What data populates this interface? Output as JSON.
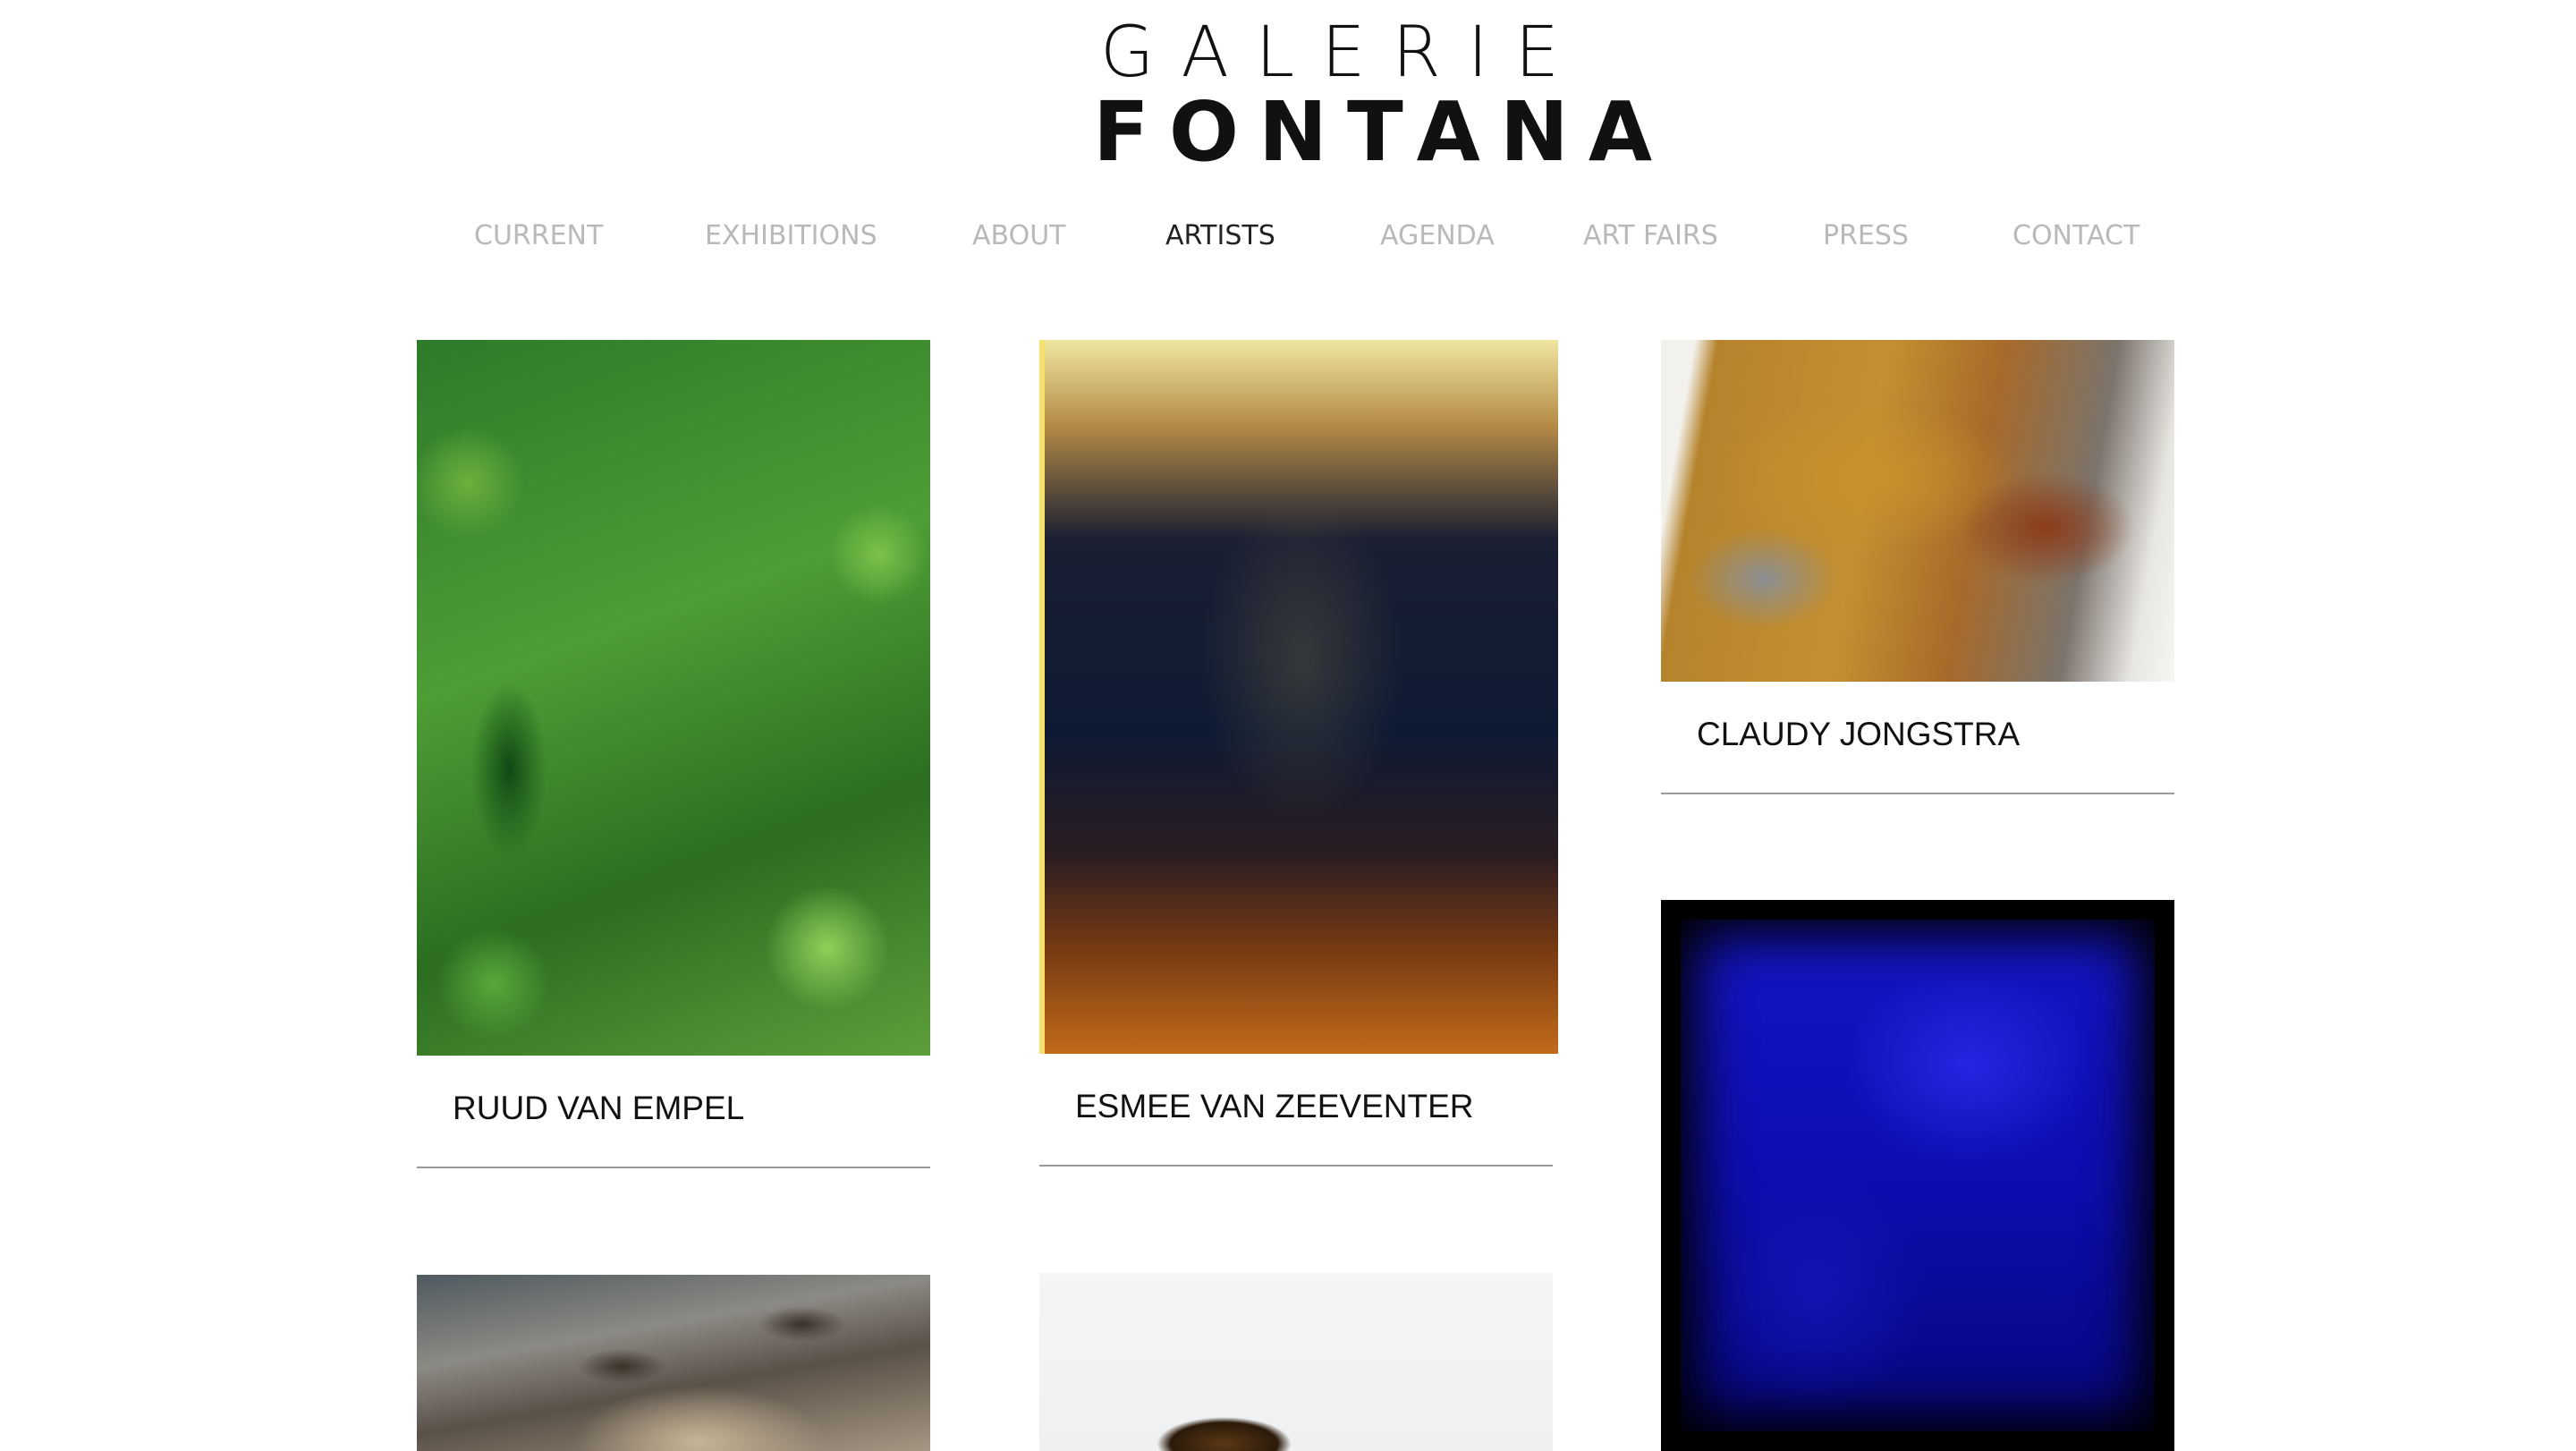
{
  "brand": {
    "line1": "GALERIE",
    "line2": "FONTANA"
  },
  "nav": {
    "items": [
      {
        "label": "CURRENT",
        "active": false
      },
      {
        "label": "EXHIBITIONS",
        "active": false
      },
      {
        "label": "ABOUT",
        "active": false
      },
      {
        "label": "ARTISTS",
        "active": true
      },
      {
        "label": "AGENDA",
        "active": false
      },
      {
        "label": "ART FAIRS",
        "active": false
      },
      {
        "label": "PRESS",
        "active": false
      },
      {
        "label": "CONTACT",
        "active": false
      }
    ]
  },
  "artists": [
    {
      "name": "RUUD VAN EMPEL",
      "image": "two-girls-in-jungle-photograph"
    },
    {
      "name": "ESMEE VAN ZEEVENTER",
      "image": "dark-plant-photograph"
    },
    {
      "name": "CLAUDY JONGSTRA",
      "image": "textile-wall-installation"
    },
    {
      "name": "",
      "image": "deep-blue-painting"
    },
    {
      "name": "",
      "image": "ruined-interior-photograph"
    },
    {
      "name": "",
      "image": "bronze-sculpture-photograph"
    }
  ],
  "colors": {
    "nav_inactive": "#b9b9b9",
    "nav_active": "#222222",
    "divider": "#9a9a9a",
    "text": "#111111"
  }
}
